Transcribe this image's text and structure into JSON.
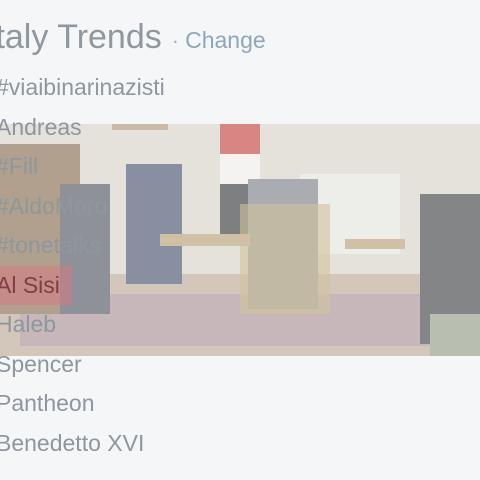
{
  "header": {
    "title": "Italy Trends",
    "separator": "·",
    "change_label": "Change"
  },
  "trends": [
    "#viaibinarinazisti",
    "Andreas",
    "#Fill",
    "#AldoMoro",
    "#tonetalks",
    "Al Sisi",
    "Haleb",
    "Spencer",
    "Pantheon",
    "Benedetto XVI"
  ],
  "highlighted_index": 5,
  "colors": {
    "background": "#f4f6f8",
    "title": "#8f979f",
    "link": "#8ea6bd",
    "trend_text": "#8e969e",
    "highlight": "#d67a82"
  }
}
